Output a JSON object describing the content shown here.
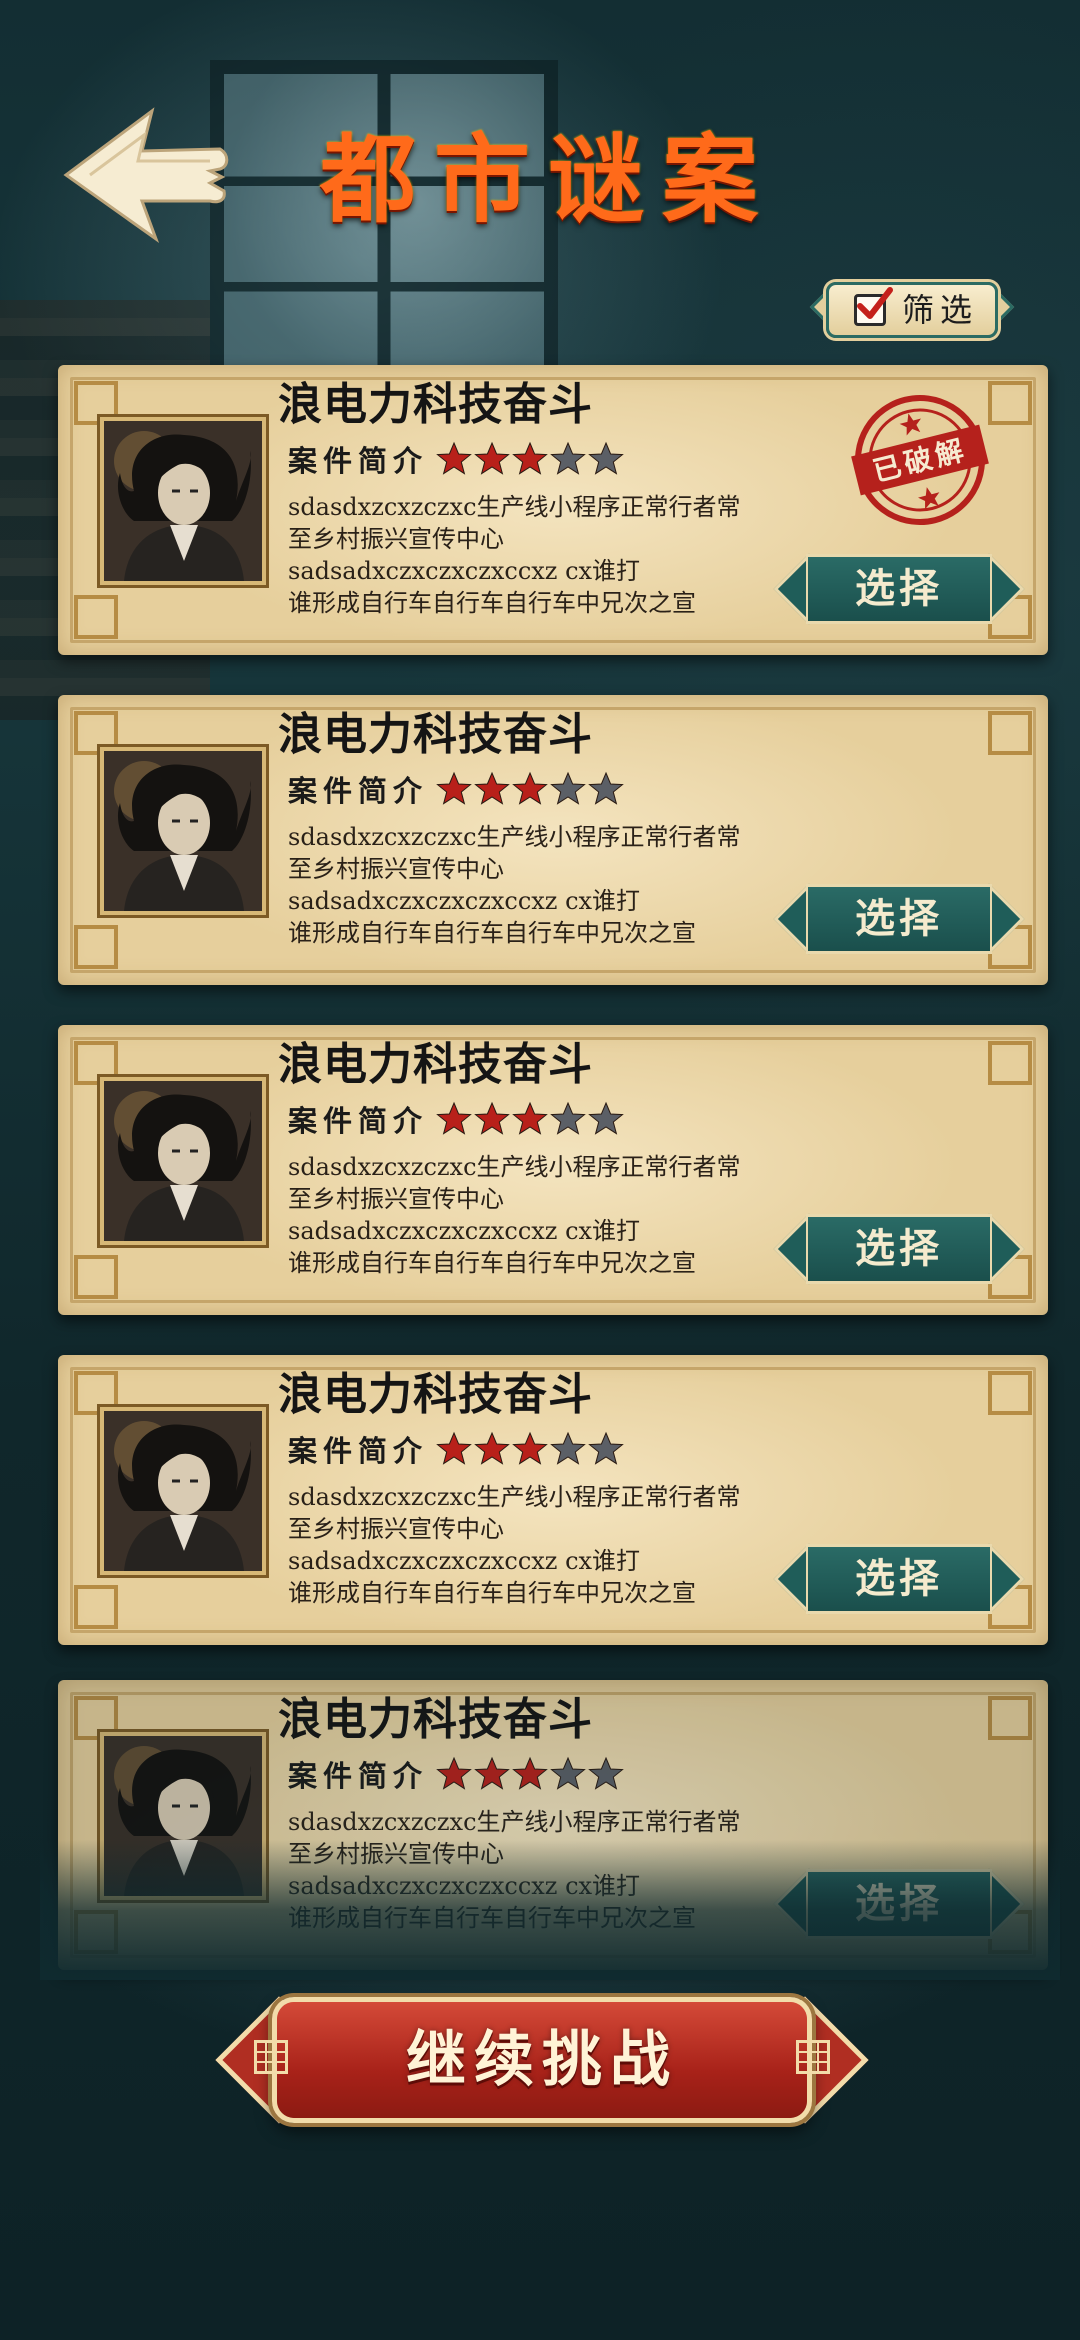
{
  "header": {
    "title": "都市谜案",
    "filter_label": "筛选",
    "filter_checked": true
  },
  "cases": [
    {
      "name": "浪电力科技奋斗",
      "brief_label": "案件简介",
      "rating": 3,
      "max_rating": 5,
      "description": [
        "sdasdxzcxzczxc生产线小程序正常行者常",
        "至乡村振兴宣传中心",
        "sadsadxczxczxczxccxz cx谁打",
        "谁形成自行车自行车自行车中兄次之宣"
      ],
      "select_label": "选择",
      "solved": true,
      "solved_label": "已破解"
    },
    {
      "name": "浪电力科技奋斗",
      "brief_label": "案件简介",
      "rating": 3,
      "max_rating": 5,
      "description": [
        "sdasdxzcxzczxc生产线小程序正常行者常",
        "至乡村振兴宣传中心",
        "sadsadxczxczxczxccxz cx谁打",
        "谁形成自行车自行车自行车中兄次之宣"
      ],
      "select_label": "选择",
      "solved": false
    },
    {
      "name": "浪电力科技奋斗",
      "brief_label": "案件简介",
      "rating": 3,
      "max_rating": 5,
      "description": [
        "sdasdxzcxzczxc生产线小程序正常行者常",
        "至乡村振兴宣传中心",
        "sadsadxczxczxczxccxz cx谁打",
        "谁形成自行车自行车自行车中兄次之宣"
      ],
      "select_label": "选择",
      "solved": false
    },
    {
      "name": "浪电力科技奋斗",
      "brief_label": "案件简介",
      "rating": 3,
      "max_rating": 5,
      "description": [
        "sdasdxzcxzczxc生产线小程序正常行者常",
        "至乡村振兴宣传中心",
        "sadsadxczxczxczxccxz cx谁打",
        "谁形成自行车自行车自行车中兄次之宣"
      ],
      "select_label": "选择",
      "solved": false
    },
    {
      "name": "浪电力科技奋斗",
      "brief_label": "案件简介",
      "rating": 3,
      "max_rating": 5,
      "description": [
        "sdasdxzcxzczxc生产线小程序正常行者常",
        "至乡村振兴宣传中心",
        "sadsadxczxczxczxccxz cx谁打",
        "谁形成自行车自行车自行车中兄次之宣"
      ],
      "select_label": "选择",
      "solved": false
    }
  ],
  "footer": {
    "continue_label": "继续挑战"
  },
  "colors": {
    "title": "#ff6a1a",
    "star_on": "#b8201a",
    "star_off": "#5b5f66",
    "button_teal": "#1f5d59",
    "button_red": "#a82219",
    "stamp_red": "#b5211c"
  },
  "icons": {
    "back": "back-arrow-icon",
    "filter": "checkbox-checked-icon",
    "star": "star-icon",
    "stamp": "solved-stamp-icon"
  }
}
